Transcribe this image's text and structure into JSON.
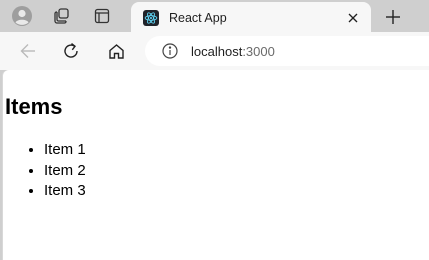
{
  "tab": {
    "title": "React App",
    "favicon": "react-logo-icon",
    "close_icon": "close-icon"
  },
  "toolbar": {
    "back_icon": "back-arrow-icon",
    "reload_icon": "reload-icon",
    "home_icon": "home-icon",
    "address_host": "localhost",
    "address_port": ":3000",
    "site_info_icon": "info-icon"
  },
  "page": {
    "heading": "Items",
    "items": [
      "Item 1",
      "Item 2",
      "Item 3"
    ]
  },
  "colors": {
    "tabstrip_bg": "#cfcfcf",
    "toolbar_bg": "#f7f7f7",
    "page_bg": "#ffffff",
    "react_blue": "#61dafb"
  }
}
